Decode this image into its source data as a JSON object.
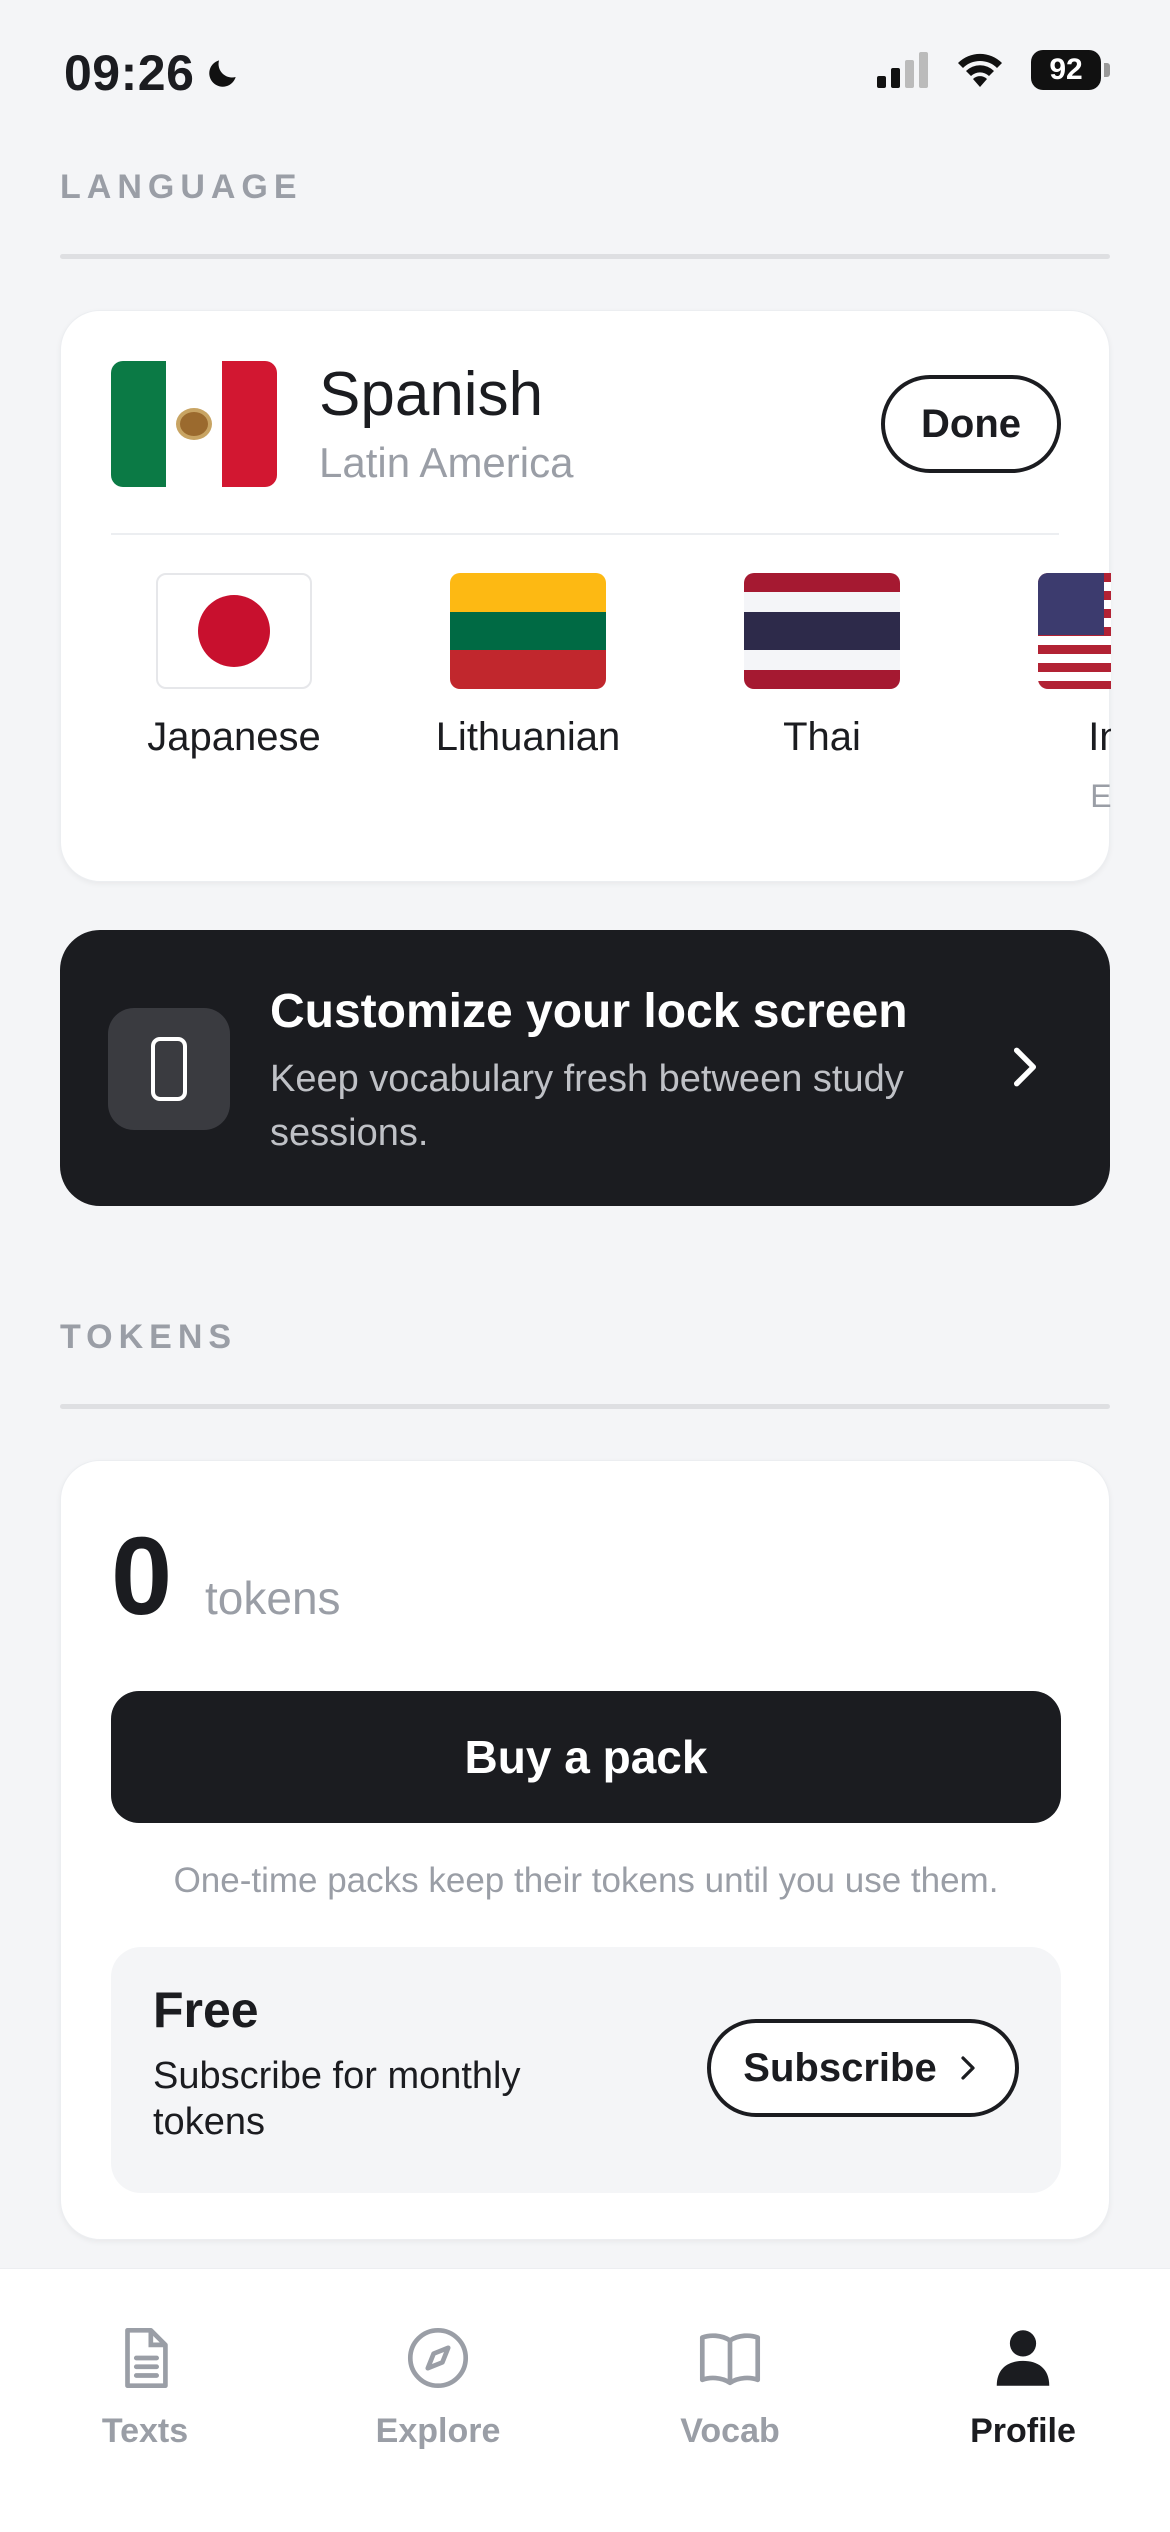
{
  "status_bar": {
    "time": "09:26",
    "battery": "92"
  },
  "language_section": {
    "label": "LANGUAGE",
    "current": {
      "name": "Spanish",
      "region": "Latin America",
      "flag": "mexico-flag"
    },
    "done_label": "Done",
    "options": [
      {
        "name": "Japanese",
        "region": "",
        "flag": "japan-flag"
      },
      {
        "name": "Lithuanian",
        "region": "",
        "flag": "lithuania-flag"
      },
      {
        "name": "Thai",
        "region": "",
        "flag": "thailand-flag"
      },
      {
        "name": "Ing",
        "region": "EE.",
        "flag": "usa-flag"
      }
    ]
  },
  "promo": {
    "title": "Customize your lock screen",
    "subtitle": "Keep vocabulary fresh between study sessions.",
    "icon": "phone-icon"
  },
  "tokens_section": {
    "label": "TOKENS",
    "count": "0",
    "unit": "tokens",
    "buy_label": "Buy a pack",
    "note": "One-time packs keep their tokens until you use them.",
    "plan": {
      "name": "Free",
      "description": "Subscribe for monthly tokens",
      "subscribe_label": "Subscribe"
    }
  },
  "tabs": [
    {
      "label": "Texts",
      "icon": "document-icon",
      "active": false
    },
    {
      "label": "Explore",
      "icon": "compass-icon",
      "active": false
    },
    {
      "label": "Vocab",
      "icon": "book-icon",
      "active": false
    },
    {
      "label": "Profile",
      "icon": "person-icon",
      "active": true
    }
  ],
  "colors": {
    "background": "#f4f5f7",
    "primary": "#1b1c20",
    "muted": "#9a9ea6",
    "card": "#ffffff"
  }
}
